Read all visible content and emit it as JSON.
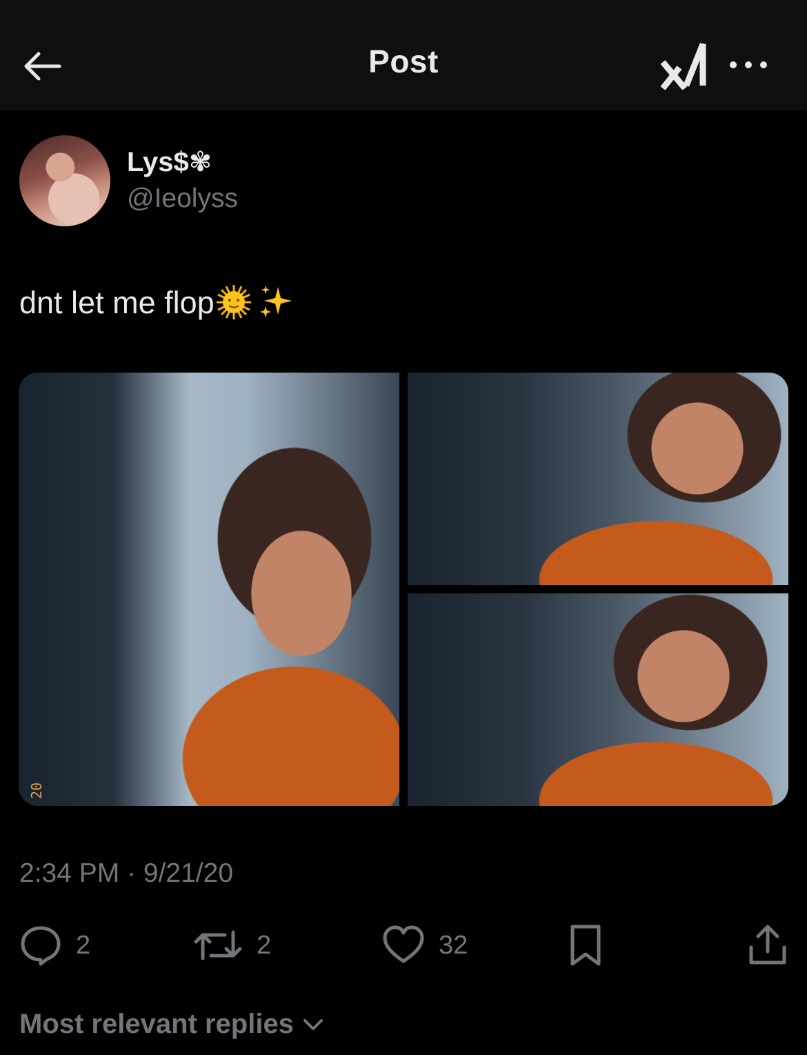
{
  "header": {
    "title": "Post"
  },
  "author": {
    "display_name": "Lys$✾",
    "handle": "@Ieolyss"
  },
  "post": {
    "text": "dnt let me flop",
    "photo_1_caption": "20"
  },
  "meta": {
    "timestamp": "2:34 PM · 9/21/20"
  },
  "actions": {
    "replies": "2",
    "reposts": "2",
    "likes": "32"
  },
  "replies_sort": {
    "label": "Most relevant replies"
  },
  "colors": {
    "background": "#000000",
    "secondary_text": "#71767b",
    "primary_text": "#e7e9ea"
  }
}
